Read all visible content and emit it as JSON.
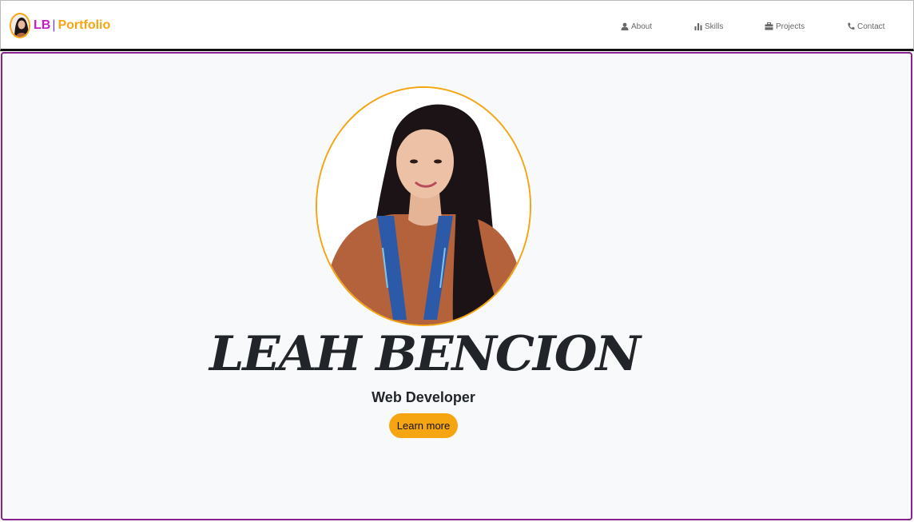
{
  "navbar": {
    "brand": {
      "initials": "LB",
      "separator": "|",
      "title": "Portfolio"
    },
    "items": [
      {
        "label": "About",
        "icon": "user-icon"
      },
      {
        "label": "Skills",
        "icon": "bar-chart-icon"
      },
      {
        "label": "Projects",
        "icon": "briefcase-icon"
      },
      {
        "label": "Contact",
        "icon": "phone-icon"
      }
    ]
  },
  "hero": {
    "name": "LEAH BENCION",
    "role": "Web Developer",
    "cta_label": "Learn more"
  },
  "colors": {
    "accent": "#f5a511",
    "brand_pink": "#c21fc4",
    "hero_border": "#8a1f8e",
    "hero_bg": "#f8f9fa",
    "text_dark": "#212529",
    "nav_text": "#666666"
  }
}
